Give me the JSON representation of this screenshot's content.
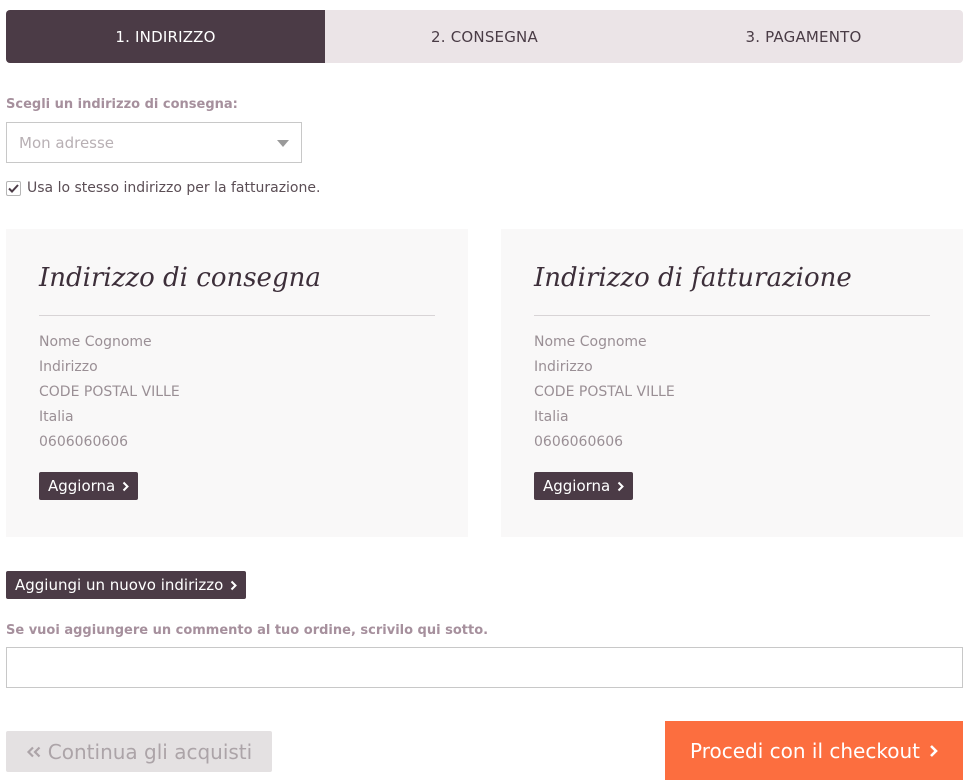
{
  "steps": [
    {
      "label": "1. INDIRIZZO",
      "active": true
    },
    {
      "label": "2. CONSEGNA",
      "active": false
    },
    {
      "label": "3. PAGAMENTO",
      "active": false
    }
  ],
  "address_select": {
    "label": "Scegli un indirizzo di consegna:",
    "value": "Mon adresse"
  },
  "same_billing": {
    "label": "Usa lo stesso indirizzo per la fatturazione.",
    "checked": true
  },
  "delivery_card": {
    "title": "Indirizzo di consegna",
    "lines": [
      "Nome Cognome",
      "Indirizzo",
      "CODE POSTAL VILLE",
      "Italia",
      "0606060606"
    ],
    "button": "Aggiorna"
  },
  "billing_card": {
    "title": "Indirizzo di fatturazione",
    "lines": [
      "Nome Cognome",
      "Indirizzo",
      "CODE POSTAL VILLE",
      "Italia",
      "0606060606"
    ],
    "button": "Aggiorna"
  },
  "add_address_button": "Aggiungi un nuovo indirizzo",
  "comment": {
    "label": "Se vuoi aggiungere un commento al tuo ordine, scrivilo qui sotto.",
    "value": ""
  },
  "back_button": "Continua gli acquisti",
  "checkout_button": "Procedi con il checkout",
  "colors": {
    "step_active": "#4b3b46",
    "step_inactive": "#ebe4e7",
    "checkout": "#fc6e3f",
    "dark_button": "#4b3b46"
  }
}
